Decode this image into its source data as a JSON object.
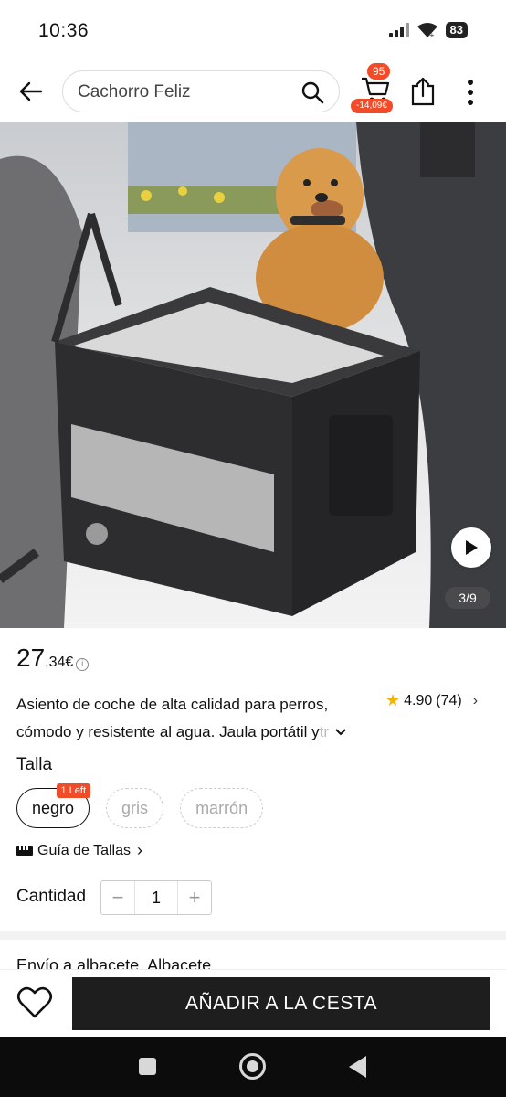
{
  "status_bar": {
    "time": "10:36",
    "battery": "83"
  },
  "search": {
    "query": "Cachorro Feliz"
  },
  "cart": {
    "count": "95",
    "discount": "-14,09€"
  },
  "gallery": {
    "counter": "3/9"
  },
  "product": {
    "price_int": "27",
    "price_dec": ",34€",
    "title_line1": "Asiento de coche de alta calidad para perros,",
    "title_line2": "cómodo y resistente al agua. Jaula portátil y",
    "title_line2_fade": " tr",
    "rating": "4.90",
    "reviews": "(74)"
  },
  "size": {
    "label": "Talla",
    "options": [
      {
        "label": "negro",
        "badge": "1 Left",
        "state": "selected"
      },
      {
        "label": "gris",
        "state": "unavailable"
      },
      {
        "label": "marrón",
        "state": "unavailable"
      }
    ],
    "guide_label": "Guía de Tallas"
  },
  "quantity": {
    "label": "Cantidad",
    "value": "1",
    "minus": "−",
    "plus": "+"
  },
  "shipping": {
    "text": "Envío a albacete, Albacete"
  },
  "bottom": {
    "add_to_cart": "AÑADIR A LA CESTA"
  },
  "colors": {
    "accent": "#f04c2a",
    "dark": "#1e1e1e",
    "star": "#f4b400"
  }
}
